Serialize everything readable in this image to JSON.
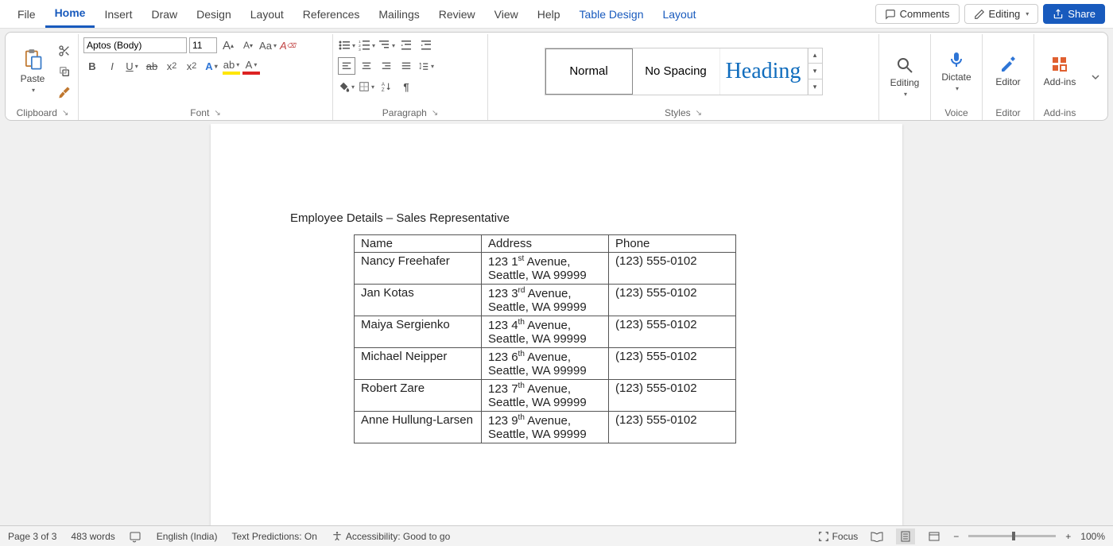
{
  "tabs": [
    "File",
    "Home",
    "Insert",
    "Draw",
    "Design",
    "Layout",
    "References",
    "Mailings",
    "Review",
    "View",
    "Help",
    "Table Design",
    "Layout"
  ],
  "active_tab": "Home",
  "contextual_start": 11,
  "header": {
    "comments": "Comments",
    "editing": "Editing",
    "share": "Share"
  },
  "ribbon": {
    "clipboard": {
      "label": "Clipboard",
      "paste": "Paste"
    },
    "font": {
      "label": "Font",
      "name": "Aptos (Body)",
      "size": "11"
    },
    "paragraph": {
      "label": "Paragraph"
    },
    "styles": {
      "label": "Styles",
      "items": [
        "Normal",
        "No Spacing",
        "Heading"
      ]
    },
    "editing": {
      "label": "Editing",
      "btn": "Editing"
    },
    "voice": {
      "label": "Voice",
      "btn": "Dictate"
    },
    "editor": {
      "label": "Editor",
      "btn": "Editor"
    },
    "addins": {
      "label": "Add-ins",
      "btn": "Add-ins"
    }
  },
  "document": {
    "title": "Employee Details – Sales Representative",
    "headers": [
      "Name",
      "Address",
      "Phone"
    ],
    "rows": [
      {
        "name": "Nancy Freehafer",
        "addr_pre": "123 1",
        "addr_ord": "st",
        "addr_rest": " Avenue, Seattle, WA 99999",
        "phone": "(123) 555-0102"
      },
      {
        "name": "Jan Kotas",
        "addr_pre": "123 3",
        "addr_ord": "rd",
        "addr_rest": " Avenue, Seattle, WA 99999",
        "phone": "(123) 555-0102"
      },
      {
        "name": "Maiya Sergienko",
        "addr_pre": "123 4",
        "addr_ord": "th",
        "addr_rest": " Avenue, Seattle, WA 99999",
        "phone": "(123) 555-0102"
      },
      {
        "name": "Michael Neipper",
        "addr_pre": "123 6",
        "addr_ord": "th",
        "addr_rest": " Avenue, Seattle, WA 99999",
        "phone": "(123) 555-0102"
      },
      {
        "name": "Robert Zare",
        "addr_pre": "123 7",
        "addr_ord": "th",
        "addr_rest": " Avenue, Seattle, WA 99999",
        "phone": "(123) 555-0102"
      },
      {
        "name": "Anne Hullung-Larsen",
        "addr_pre": "123 9",
        "addr_ord": "th",
        "addr_rest": " Avenue, Seattle, WA 99999",
        "phone": "(123) 555-0102"
      }
    ]
  },
  "status": {
    "page": "Page 3 of 3",
    "words": "483 words",
    "lang": "English (India)",
    "predictions": "Text Predictions: On",
    "accessibility": "Accessibility: Good to go",
    "focus": "Focus",
    "zoom": "100%"
  }
}
